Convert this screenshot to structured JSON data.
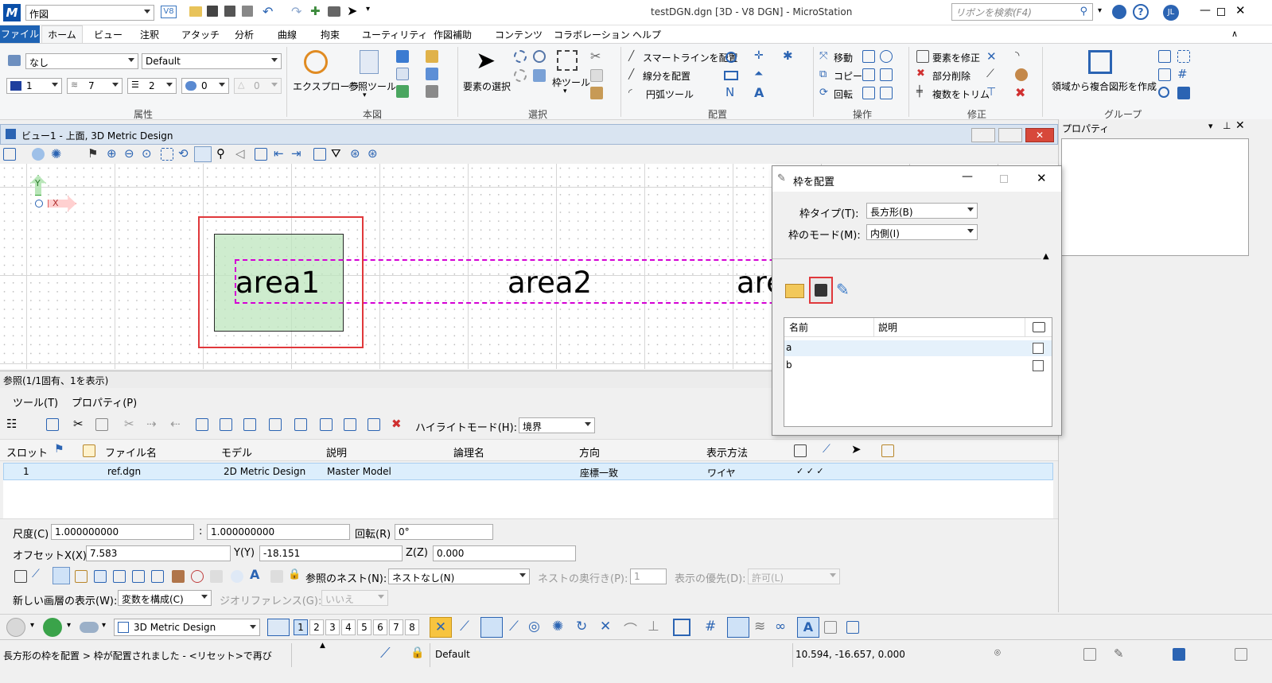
{
  "app": {
    "window_title": "testDGN.dgn [3D - V8 DGN] - MicroStation",
    "workflow": "作図",
    "search_placeholder": "リボンを検索(F4)",
    "user_initials": "JL"
  },
  "ribbon": {
    "tabs": [
      "ファイル",
      "ホーム",
      "ビュー",
      "注釈",
      "アタッチ",
      "分析",
      "曲線",
      "拘束",
      "ユーティリティ",
      "作図補助",
      "コンテンツ",
      "コラボレーション",
      "ヘルプ"
    ],
    "attributes": {
      "level": "なし",
      "style": "Default",
      "color": "1",
      "line_style": "7",
      "weight": "2",
      "transparency": "0",
      "priority": "0",
      "label": "属性"
    },
    "primary": {
      "explorer": "エクスプローラ",
      "ref_tool": "参照ツール",
      "label": "本図"
    },
    "selection": {
      "select": "要素の選択",
      "fence": "枠ツール",
      "label": "選択"
    },
    "placement": {
      "smartline": "スマートラインを配置",
      "line": "線分を配置",
      "arc": "円弧ツール",
      "label": "配置"
    },
    "manipulate": {
      "move": "移動",
      "copy": "コピー",
      "rotate": "回転",
      "label": "操作"
    },
    "modify": {
      "modify": "要素を修正",
      "partial_delete": "部分削除",
      "trim_multiple": "複数をトリム",
      "label": "修正"
    },
    "groups": {
      "create_region": "領域から複合図形を作成",
      "label": "グループ"
    }
  },
  "view": {
    "title": "ビュー1 - 上面, 3D Metric Design",
    "axis_y": "Y",
    "axis_x": "X",
    "areas": [
      "area1",
      "area2",
      "are"
    ]
  },
  "properties_panel": {
    "title": "プロパティ"
  },
  "references": {
    "title": "参照(1/1固有、1を表示)",
    "menu": [
      "ツール(T)",
      "プロパティ(P)"
    ],
    "highlight_label": "ハイライトモード(H):",
    "highlight_value": "境界",
    "columns": [
      "スロット",
      "ファイル名",
      "モデル",
      "説明",
      "論理名",
      "方向",
      "表示方法"
    ],
    "rows": [
      {
        "slot": "1",
        "file": "ref.dgn",
        "model": "2D Metric Design",
        "desc": "Master Model",
        "logical": "",
        "orientation": "座標一致",
        "display": "ワイヤ",
        "checks": "✓  ✓  ✓"
      }
    ],
    "scale_label": "尺度(C)",
    "scale_a": "1.000000000",
    "scale_sep": ":",
    "scale_b": "1.000000000",
    "rotation_label": "回転(R)",
    "rotation": "0°",
    "offset_x_label": "オフセットX(X)",
    "offset_x": "7.583",
    "offset_y_label": "Y(Y)",
    "offset_y": "-18.151",
    "offset_z_label": "Z(Z)",
    "offset_z": "0.000",
    "nest_label": "参照のネスト(N):",
    "nest_value": "ネストなし(N)",
    "nest_depth_label": "ネストの奥行き(P):",
    "nest_depth": "1",
    "display_priority_label": "表示の優先(D):",
    "display_priority": "許可(L)",
    "new_level_label": "新しい画層の表示(W):",
    "new_level_value": "変数を構成(C)",
    "georef_label": "ジオリファレンス(G):",
    "georef_value": "いいえ"
  },
  "dialog": {
    "title": "枠を配置",
    "fence_type_label": "枠タイプ(T):",
    "fence_type_value": "長方形(B)",
    "fence_mode_label": "枠のモード(M):",
    "fence_mode_value": "内側(I)",
    "col_name": "名前",
    "col_desc": "説明",
    "items": [
      "a",
      "b"
    ]
  },
  "bottom_toolbar": {
    "model": "3D Metric Design",
    "views": [
      "1",
      "2",
      "3",
      "4",
      "5",
      "6",
      "7",
      "8"
    ]
  },
  "status": {
    "message": "長方形の枠を配置 > 枠が配置されました - <リセット>で再び",
    "level": "Default",
    "coords": "10.594, -16.657, 0.000"
  },
  "colors": {
    "file_tab": "#1e63b4",
    "highlight_red": "#e0383b",
    "fence_magenta": "#d400d4",
    "area_fill": "#cdeccd"
  }
}
